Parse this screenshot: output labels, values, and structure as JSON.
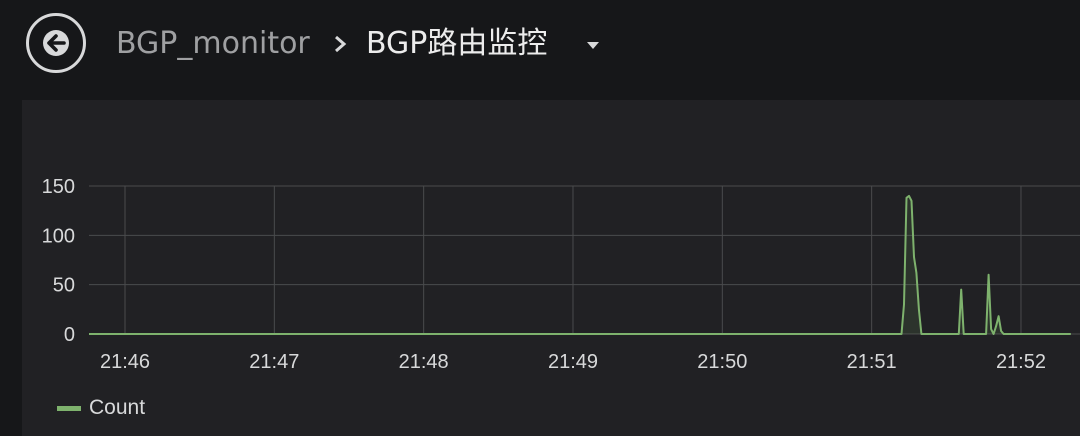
{
  "header": {
    "parent": "BGP_monitor",
    "title": "BGP路由监控"
  },
  "colors": {
    "background": "#161719",
    "panel": "#212124",
    "series": "#7eb26d",
    "grid": "#4a4b4d",
    "text": "#d8d9da"
  },
  "chart_data": {
    "type": "line",
    "title": "",
    "xlabel": "",
    "ylabel": "",
    "ylim": [
      0,
      150
    ],
    "y_ticks": [
      "0",
      "50",
      "100",
      "150"
    ],
    "x_ticks": [
      "21:46",
      "21:47",
      "21:48",
      "21:49",
      "21:50",
      "21:51",
      "21:52"
    ],
    "grid": true,
    "legend": "bottom-left",
    "series": [
      {
        "name": "Count",
        "color": "#7eb26d",
        "x": [
          "21:45:40",
          "21:46",
          "21:47",
          "21:48",
          "21:49",
          "21:50",
          "21:51",
          "21:51:12",
          "21:51:13",
          "21:51:14",
          "21:51:15",
          "21:51:16",
          "21:51:17",
          "21:51:18",
          "21:51:19",
          "21:51:20",
          "21:51:21",
          "21:51:22",
          "21:51:35",
          "21:51:36",
          "21:51:37",
          "21:51:38",
          "21:51:46",
          "21:51:47",
          "21:51:48",
          "21:51:49",
          "21:51:50",
          "21:51:51",
          "21:51:52",
          "21:51:53",
          "21:51:54",
          "21:52",
          "21:52:20"
        ],
        "values": [
          0,
          0,
          0,
          0,
          0,
          0,
          0,
          0,
          30,
          138,
          140,
          135,
          78,
          62,
          25,
          0,
          0,
          0,
          0,
          45,
          0,
          0,
          0,
          60,
          5,
          0,
          8,
          18,
          3,
          0,
          0,
          0,
          0
        ]
      }
    ]
  }
}
